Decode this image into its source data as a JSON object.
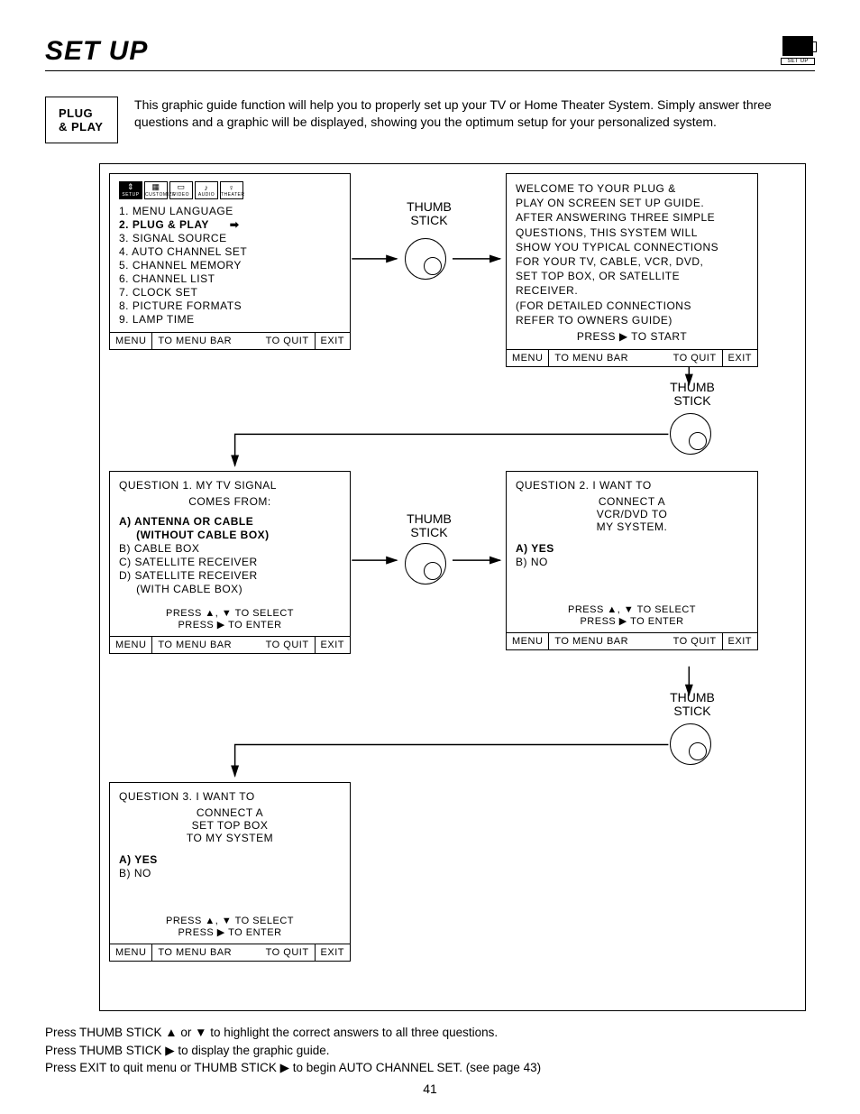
{
  "header": {
    "title": "SET UP",
    "corner_label": "SET UP"
  },
  "intro": {
    "box_label": "PLUG & PLAY",
    "text": "This graphic guide function will help you to properly set up your TV or Home Theater System.  Simply answer three questions and a graphic will be displayed, showing you the optimum setup for your personalized system."
  },
  "iconbar": [
    "SETUP",
    "CUSTOMIZE",
    "VIDEO",
    "AUDIO",
    "THEATER"
  ],
  "menu_items": [
    "1. MENU LANGUAGE",
    "2. PLUG & PLAY",
    "3. SIGNAL SOURCE",
    "4. AUTO CHANNEL SET",
    "5. CHANNEL MEMORY",
    "6. CHANNEL LIST",
    "7. CLOCK SET",
    "8. PICTURE FORMATS",
    "9. LAMP TIME"
  ],
  "menu_bold_index": 1,
  "footer_bar": {
    "menu": "MENU",
    "to_menu_bar": "TO MENU BAR",
    "to_quit": "TO QUIT",
    "exit": "EXIT"
  },
  "thumb_label": "THUMB\nSTICK",
  "welcome": {
    "lines": [
      "WELCOME TO YOUR PLUG &",
      "PLAY ON SCREEN SET UP GUIDE.",
      "AFTER ANSWERING THREE SIMPLE",
      "QUESTIONS, THIS SYSTEM WILL",
      "SHOW YOU TYPICAL CONNECTIONS",
      "FOR YOUR TV, CABLE, VCR, DVD,",
      "SET TOP BOX, OR SATELLITE",
      "RECEIVER.",
      "(FOR DETAILED CONNECTIONS",
      "REFER TO OWNERS GUIDE)"
    ],
    "press": "PRESS ▶ TO START"
  },
  "q1": {
    "title": "QUESTION 1.  MY TV SIGNAL",
    "subtitle": "COMES FROM:",
    "opts": [
      "A) ANTENNA OR CABLE",
      "     (WITHOUT CABLE BOX)",
      "B) CABLE BOX",
      "C) SATELLITE RECEIVER",
      "D) SATELLITE RECEIVER",
      "     (WITH CABLE BOX)"
    ],
    "bold_indices": [
      0,
      1
    ],
    "press1": "PRESS ▲, ▼ TO SELECT",
    "press2": "PRESS ▶ TO ENTER"
  },
  "q2": {
    "title": "QUESTION 2. I WANT TO",
    "sub1": "CONNECT A",
    "sub2": "VCR/DVD TO",
    "sub3": "MY SYSTEM.",
    "optA": "A) YES",
    "optB": "B) NO",
    "press1": "PRESS ▲, ▼ TO SELECT",
    "press2": "PRESS ▶ TO ENTER"
  },
  "q3": {
    "title": "QUESTION 3. I WANT TO",
    "sub1": "CONNECT A",
    "sub2": "SET TOP BOX",
    "sub3": "TO MY SYSTEM",
    "optA": "A) YES",
    "optB": "B) NO",
    "press1": "PRESS ▲, ▼ TO SELECT",
    "press2": "PRESS ▶ TO ENTER"
  },
  "bottom": {
    "l1": "Press  THUMB STICK ▲ or ▼ to highlight the correct answers to all three questions.",
    "l2": "Press THUMB STICK ▶ to display the graphic guide.",
    "l3": "Press EXIT to quit menu or THUMB STICK ▶ to begin AUTO CHANNEL SET. (see page 43)"
  },
  "page_number": "41"
}
